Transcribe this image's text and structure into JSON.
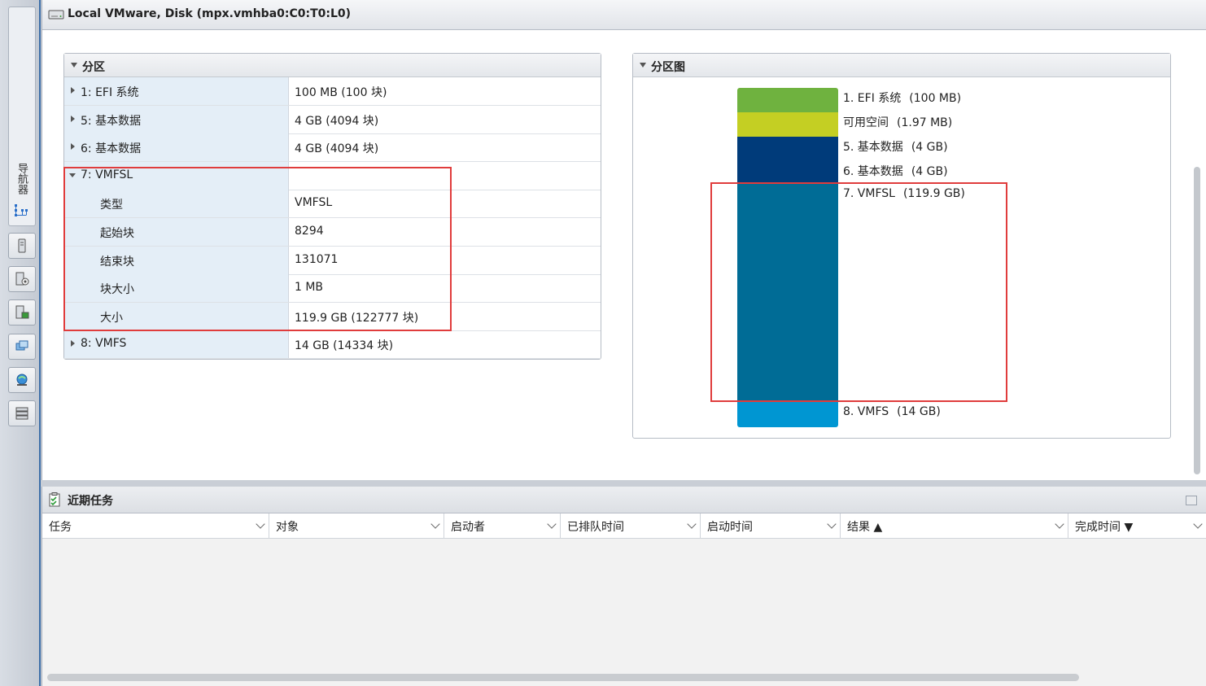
{
  "navigator": {
    "label": "导航器",
    "icons": [
      "host-icon",
      "manage-icon",
      "monitor-icon",
      "vm-icon",
      "network-icon",
      "storage-icon"
    ]
  },
  "header": {
    "title": "Local VMware, Disk (mpx.vmhba0:C0:T0:L0)"
  },
  "partitions": {
    "title": "分区",
    "rows": [
      {
        "label": "1: EFI 系统",
        "value": "100 MB (100 块)",
        "expandable": true,
        "expanded": false
      },
      {
        "label": "5: 基本数据",
        "value": "4 GB (4094 块)",
        "expandable": true,
        "expanded": false
      },
      {
        "label": "6: 基本数据",
        "value": "4 GB (4094 块)",
        "expandable": true,
        "expanded": false
      },
      {
        "label": "7: VMFSL",
        "value": "",
        "expandable": true,
        "expanded": true
      },
      {
        "label": "类型",
        "value": "VMFSL",
        "child": true
      },
      {
        "label": "起始块",
        "value": "8294",
        "child": true
      },
      {
        "label": "结束块",
        "value": "131071",
        "child": true
      },
      {
        "label": "块大小",
        "value": "1 MB",
        "child": true
      },
      {
        "label": "大小",
        "value": "119.9 GB (122777 块)",
        "child": true
      },
      {
        "label": "8: VMFS",
        "value": "14 GB (14334 块)",
        "expandable": true,
        "expanded": false
      }
    ]
  },
  "partition_map": {
    "title": "分区图",
    "segments": [
      {
        "name": "1. EFI 系统",
        "size": "(100 MB)",
        "color": "#6fb23f"
      },
      {
        "name": "可用空间",
        "size": "(1.97 MB)",
        "color": "#c4cf23"
      },
      {
        "name": "5. 基本数据",
        "size": "(4 GB)",
        "color": "#003b7a"
      },
      {
        "name": "6. 基本数据",
        "size": "(4 GB)",
        "color": "#003b7a"
      },
      {
        "name": "7. VMFSL",
        "size": "(119.9 GB)",
        "color": "#006c96"
      },
      {
        "name": "8. VMFS",
        "size": "(14 GB)",
        "color": "#0096d2"
      }
    ]
  },
  "tasks": {
    "title": "近期任务",
    "columns": [
      "任务",
      "对象",
      "启动者",
      "已排队时间",
      "启动时间",
      "结果 ▲",
      "完成时间 ▼"
    ]
  },
  "colors": {
    "highlight": "#e03c3c",
    "row_label_bg": "#e4eef7",
    "nav_accent": "#3d6ea8"
  }
}
